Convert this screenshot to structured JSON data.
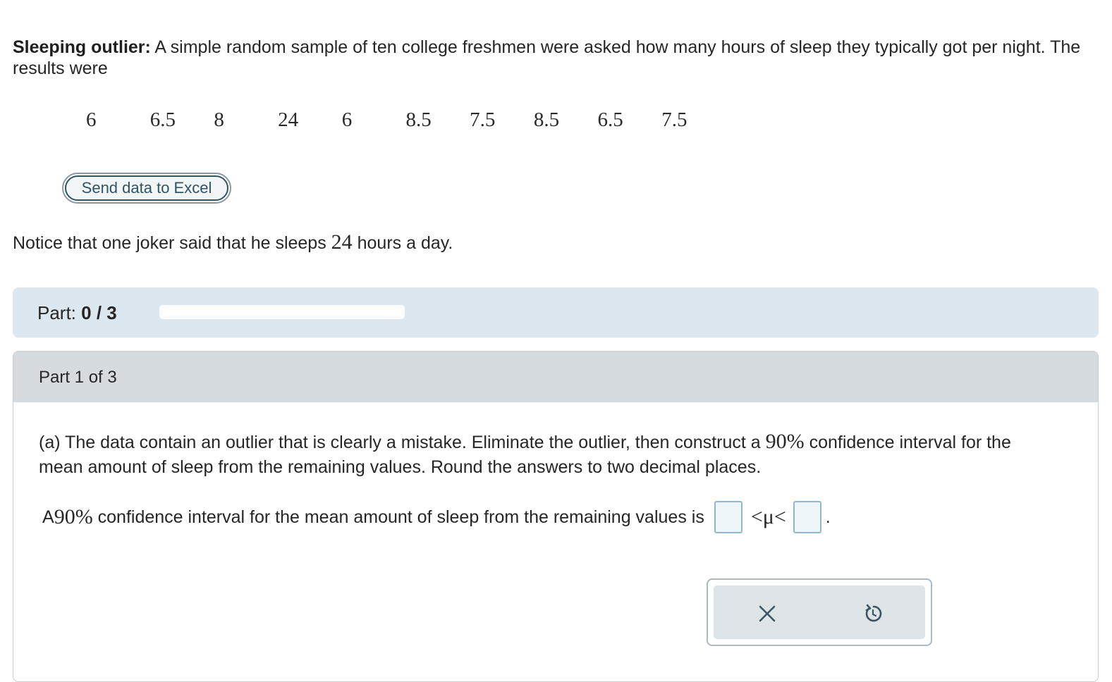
{
  "intro": {
    "title": "Sleeping outlier:",
    "text": " A simple random sample of ten college freshmen were asked how many hours of sleep they typically got per night. The results were"
  },
  "data_values": [
    "6",
    "6.5",
    "8",
    "24",
    "6",
    "8.5",
    "7.5",
    "8.5",
    "6.5",
    "7.5"
  ],
  "excel_button": {
    "label": "Send data to Excel"
  },
  "notice": {
    "before": "Notice that one joker said that he sleeps ",
    "value": "24",
    "after": " hours a day."
  },
  "progress": {
    "label": "Part:",
    "value": "0 / 3",
    "fraction": 0
  },
  "part": {
    "title": "Part 1 of 3",
    "question_before": "(a) The data contain an outlier that is clearly a mistake. Eliminate the outlier, then construct a ",
    "question_pct": "90%",
    "question_after": " confidence interval for the mean amount of sleep from the remaining values. Round the answers to two decimal places.",
    "answer_before": "A ",
    "answer_pct": "90%",
    "answer_after": " confidence interval for the mean amount of sleep from the remaining values is",
    "answer_symbol": "<μ<",
    "answer_period": ".",
    "lower_value": "",
    "upper_value": ""
  },
  "actions": {
    "clear_icon": "x-icon",
    "reset_icon": "undo-icon"
  },
  "colors": {
    "progress_panel": "#dde7ef",
    "part_header": "#d5dbdf",
    "button_text": "#2f5462",
    "answer_box_border": "#8fb8cf"
  }
}
